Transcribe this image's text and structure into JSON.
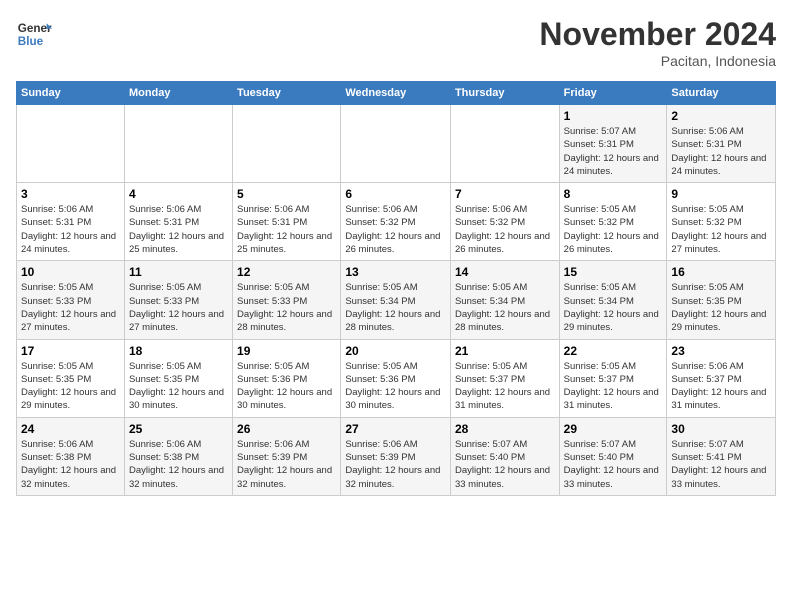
{
  "logo": {
    "line1": "General",
    "line2": "Blue"
  },
  "title": "November 2024",
  "subtitle": "Pacitan, Indonesia",
  "weekdays": [
    "Sunday",
    "Monday",
    "Tuesday",
    "Wednesday",
    "Thursday",
    "Friday",
    "Saturday"
  ],
  "weeks": [
    [
      {
        "day": "",
        "info": ""
      },
      {
        "day": "",
        "info": ""
      },
      {
        "day": "",
        "info": ""
      },
      {
        "day": "",
        "info": ""
      },
      {
        "day": "",
        "info": ""
      },
      {
        "day": "1",
        "info": "Sunrise: 5:07 AM\nSunset: 5:31 PM\nDaylight: 12 hours and 24 minutes."
      },
      {
        "day": "2",
        "info": "Sunrise: 5:06 AM\nSunset: 5:31 PM\nDaylight: 12 hours and 24 minutes."
      }
    ],
    [
      {
        "day": "3",
        "info": "Sunrise: 5:06 AM\nSunset: 5:31 PM\nDaylight: 12 hours and 24 minutes."
      },
      {
        "day": "4",
        "info": "Sunrise: 5:06 AM\nSunset: 5:31 PM\nDaylight: 12 hours and 25 minutes."
      },
      {
        "day": "5",
        "info": "Sunrise: 5:06 AM\nSunset: 5:31 PM\nDaylight: 12 hours and 25 minutes."
      },
      {
        "day": "6",
        "info": "Sunrise: 5:06 AM\nSunset: 5:32 PM\nDaylight: 12 hours and 26 minutes."
      },
      {
        "day": "7",
        "info": "Sunrise: 5:06 AM\nSunset: 5:32 PM\nDaylight: 12 hours and 26 minutes."
      },
      {
        "day": "8",
        "info": "Sunrise: 5:05 AM\nSunset: 5:32 PM\nDaylight: 12 hours and 26 minutes."
      },
      {
        "day": "9",
        "info": "Sunrise: 5:05 AM\nSunset: 5:32 PM\nDaylight: 12 hours and 27 minutes."
      }
    ],
    [
      {
        "day": "10",
        "info": "Sunrise: 5:05 AM\nSunset: 5:33 PM\nDaylight: 12 hours and 27 minutes."
      },
      {
        "day": "11",
        "info": "Sunrise: 5:05 AM\nSunset: 5:33 PM\nDaylight: 12 hours and 27 minutes."
      },
      {
        "day": "12",
        "info": "Sunrise: 5:05 AM\nSunset: 5:33 PM\nDaylight: 12 hours and 28 minutes."
      },
      {
        "day": "13",
        "info": "Sunrise: 5:05 AM\nSunset: 5:34 PM\nDaylight: 12 hours and 28 minutes."
      },
      {
        "day": "14",
        "info": "Sunrise: 5:05 AM\nSunset: 5:34 PM\nDaylight: 12 hours and 28 minutes."
      },
      {
        "day": "15",
        "info": "Sunrise: 5:05 AM\nSunset: 5:34 PM\nDaylight: 12 hours and 29 minutes."
      },
      {
        "day": "16",
        "info": "Sunrise: 5:05 AM\nSunset: 5:35 PM\nDaylight: 12 hours and 29 minutes."
      }
    ],
    [
      {
        "day": "17",
        "info": "Sunrise: 5:05 AM\nSunset: 5:35 PM\nDaylight: 12 hours and 29 minutes."
      },
      {
        "day": "18",
        "info": "Sunrise: 5:05 AM\nSunset: 5:35 PM\nDaylight: 12 hours and 30 minutes."
      },
      {
        "day": "19",
        "info": "Sunrise: 5:05 AM\nSunset: 5:36 PM\nDaylight: 12 hours and 30 minutes."
      },
      {
        "day": "20",
        "info": "Sunrise: 5:05 AM\nSunset: 5:36 PM\nDaylight: 12 hours and 30 minutes."
      },
      {
        "day": "21",
        "info": "Sunrise: 5:05 AM\nSunset: 5:37 PM\nDaylight: 12 hours and 31 minutes."
      },
      {
        "day": "22",
        "info": "Sunrise: 5:05 AM\nSunset: 5:37 PM\nDaylight: 12 hours and 31 minutes."
      },
      {
        "day": "23",
        "info": "Sunrise: 5:06 AM\nSunset: 5:37 PM\nDaylight: 12 hours and 31 minutes."
      }
    ],
    [
      {
        "day": "24",
        "info": "Sunrise: 5:06 AM\nSunset: 5:38 PM\nDaylight: 12 hours and 32 minutes."
      },
      {
        "day": "25",
        "info": "Sunrise: 5:06 AM\nSunset: 5:38 PM\nDaylight: 12 hours and 32 minutes."
      },
      {
        "day": "26",
        "info": "Sunrise: 5:06 AM\nSunset: 5:39 PM\nDaylight: 12 hours and 32 minutes."
      },
      {
        "day": "27",
        "info": "Sunrise: 5:06 AM\nSunset: 5:39 PM\nDaylight: 12 hours and 32 minutes."
      },
      {
        "day": "28",
        "info": "Sunrise: 5:07 AM\nSunset: 5:40 PM\nDaylight: 12 hours and 33 minutes."
      },
      {
        "day": "29",
        "info": "Sunrise: 5:07 AM\nSunset: 5:40 PM\nDaylight: 12 hours and 33 minutes."
      },
      {
        "day": "30",
        "info": "Sunrise: 5:07 AM\nSunset: 5:41 PM\nDaylight: 12 hours and 33 minutes."
      }
    ]
  ]
}
